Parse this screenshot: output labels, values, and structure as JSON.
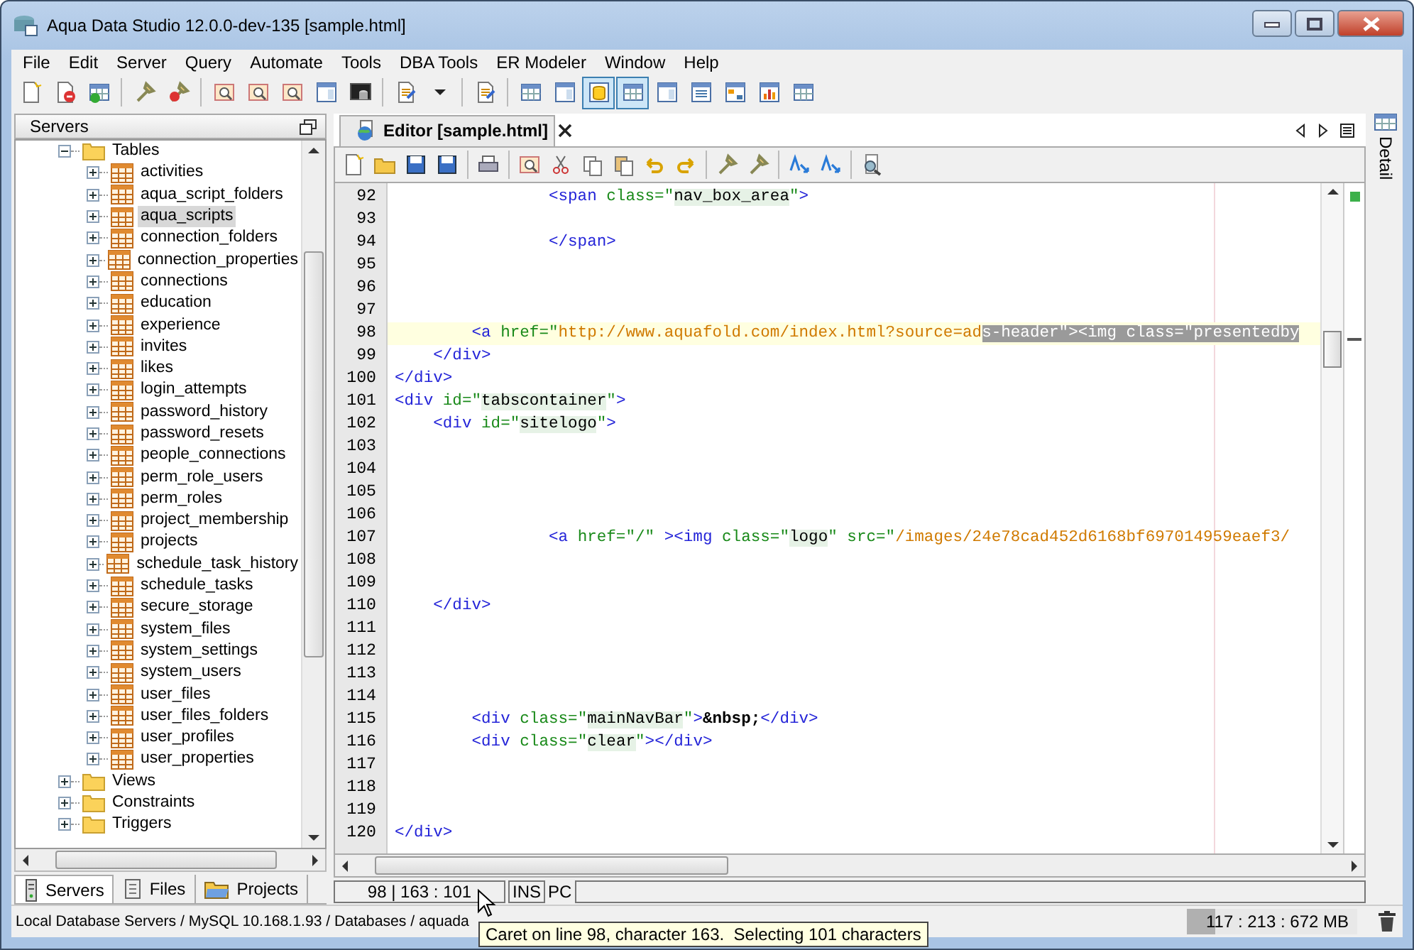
{
  "window": {
    "title": "Aqua Data Studio 12.0.0-dev-135 [sample.html]"
  },
  "menu": [
    "File",
    "Edit",
    "Server",
    "Query",
    "Automate",
    "Tools",
    "DBA Tools",
    "ER Modeler",
    "Window",
    "Help"
  ],
  "main_toolbar": [
    {
      "kind": "page",
      "pressed": false
    },
    {
      "kind": "page-remove",
      "pressed": false
    },
    {
      "kind": "table-add",
      "pressed": false
    },
    {
      "kind": "separator"
    },
    {
      "kind": "tool",
      "pressed": false
    },
    {
      "kind": "tool-remove",
      "pressed": false
    },
    {
      "kind": "separator"
    },
    {
      "kind": "query",
      "pressed": false
    },
    {
      "kind": "query",
      "pressed": false
    },
    {
      "kind": "query",
      "pressed": false
    },
    {
      "kind": "window",
      "pressed": false
    },
    {
      "kind": "db-window",
      "pressed": false
    },
    {
      "kind": "separator"
    },
    {
      "kind": "script",
      "pressed": false
    },
    {
      "kind": "caret",
      "pressed": false
    },
    {
      "kind": "separator"
    },
    {
      "kind": "script",
      "pressed": false
    },
    {
      "kind": "separator"
    },
    {
      "kind": "table",
      "pressed": false
    },
    {
      "kind": "window",
      "pressed": false
    },
    {
      "kind": "db",
      "pressed": true
    },
    {
      "kind": "table",
      "pressed": true
    },
    {
      "kind": "window",
      "pressed": false
    },
    {
      "kind": "list",
      "pressed": false
    },
    {
      "kind": "tree",
      "pressed": false
    },
    {
      "kind": "chart",
      "pressed": false
    },
    {
      "kind": "table",
      "pressed": false
    }
  ],
  "servers_panel": {
    "title": "Servers",
    "tree": [
      {
        "label": "Tables",
        "kind": "folder",
        "expanded": true,
        "selected": false,
        "children": [
          {
            "label": "activities",
            "kind": "table",
            "expanded": false,
            "selected": false
          },
          {
            "label": "aqua_script_folders",
            "kind": "table",
            "expanded": false,
            "selected": false
          },
          {
            "label": "aqua_scripts",
            "kind": "table",
            "expanded": false,
            "selected": true
          },
          {
            "label": "connection_folders",
            "kind": "table",
            "expanded": false,
            "selected": false
          },
          {
            "label": "connection_properties",
            "kind": "table",
            "expanded": false,
            "selected": false
          },
          {
            "label": "connections",
            "kind": "table",
            "expanded": false,
            "selected": false
          },
          {
            "label": "education",
            "kind": "table",
            "expanded": false,
            "selected": false
          },
          {
            "label": "experience",
            "kind": "table",
            "expanded": false,
            "selected": false
          },
          {
            "label": "invites",
            "kind": "table",
            "expanded": false,
            "selected": false
          },
          {
            "label": "likes",
            "kind": "table",
            "expanded": false,
            "selected": false
          },
          {
            "label": "login_attempts",
            "kind": "table",
            "expanded": false,
            "selected": false
          },
          {
            "label": "password_history",
            "kind": "table",
            "expanded": false,
            "selected": false
          },
          {
            "label": "password_resets",
            "kind": "table",
            "expanded": false,
            "selected": false
          },
          {
            "label": "people_connections",
            "kind": "table",
            "expanded": false,
            "selected": false
          },
          {
            "label": "perm_role_users",
            "kind": "table",
            "expanded": false,
            "selected": false
          },
          {
            "label": "perm_roles",
            "kind": "table",
            "expanded": false,
            "selected": false
          },
          {
            "label": "project_membership",
            "kind": "table",
            "expanded": false,
            "selected": false
          },
          {
            "label": "projects",
            "kind": "table",
            "expanded": false,
            "selected": false
          },
          {
            "label": "schedule_task_history",
            "kind": "table",
            "expanded": false,
            "selected": false
          },
          {
            "label": "schedule_tasks",
            "kind": "table",
            "expanded": false,
            "selected": false
          },
          {
            "label": "secure_storage",
            "kind": "table",
            "expanded": false,
            "selected": false
          },
          {
            "label": "system_files",
            "kind": "table",
            "expanded": false,
            "selected": false
          },
          {
            "label": "system_settings",
            "kind": "table",
            "expanded": false,
            "selected": false
          },
          {
            "label": "system_users",
            "kind": "table",
            "expanded": false,
            "selected": false
          },
          {
            "label": "user_files",
            "kind": "table",
            "expanded": false,
            "selected": false
          },
          {
            "label": "user_files_folders",
            "kind": "table",
            "expanded": false,
            "selected": false
          },
          {
            "label": "user_profiles",
            "kind": "table",
            "expanded": false,
            "selected": false
          },
          {
            "label": "user_properties",
            "kind": "table",
            "expanded": false,
            "selected": false
          }
        ]
      },
      {
        "label": "Views",
        "kind": "folder",
        "expanded": false,
        "selected": false
      },
      {
        "label": "Constraints",
        "kind": "folder",
        "expanded": false,
        "selected": false
      },
      {
        "label": "Triggers",
        "kind": "folder",
        "expanded": false,
        "selected": false
      }
    ],
    "tabs": [
      {
        "label": "Servers",
        "kind": "servers",
        "selected": true
      },
      {
        "label": "Files",
        "kind": "files",
        "selected": false
      },
      {
        "label": "Projects",
        "kind": "projects",
        "selected": false
      }
    ]
  },
  "editor": {
    "tab": {
      "label": "Editor [sample.html]"
    },
    "toolbar": [
      {
        "kind": "page"
      },
      {
        "kind": "folder"
      },
      {
        "kind": "disk"
      },
      {
        "kind": "disk-all"
      },
      {
        "kind": "separator"
      },
      {
        "kind": "printer"
      },
      {
        "kind": "separator"
      },
      {
        "kind": "select"
      },
      {
        "kind": "scissors"
      },
      {
        "kind": "copy"
      },
      {
        "kind": "paste"
      },
      {
        "kind": "undo"
      },
      {
        "kind": "redo"
      },
      {
        "kind": "separator"
      },
      {
        "kind": "tool"
      },
      {
        "kind": "tool"
      },
      {
        "kind": "separator"
      },
      {
        "kind": "case"
      },
      {
        "kind": "case"
      },
      {
        "kind": "separator"
      },
      {
        "kind": "find"
      }
    ],
    "lines": [
      {
        "number": "92",
        "current": false,
        "tokens": [
          {
            "t": "                <span ",
            "kind": "tag"
          },
          {
            "t": "class=\"",
            "kind": "attr"
          },
          {
            "t": "nav_box_area",
            "kind": "val"
          },
          {
            "t": "\"",
            "kind": "attr"
          },
          {
            "t": ">",
            "kind": "tag"
          }
        ]
      },
      {
        "number": "93",
        "current": false
      },
      {
        "number": "94",
        "current": false,
        "tokens": [
          {
            "t": "                </span>",
            "kind": "tag"
          }
        ]
      },
      {
        "number": "95",
        "current": false
      },
      {
        "number": "96",
        "current": false
      },
      {
        "number": "97",
        "current": false
      },
      {
        "number": "98",
        "current": true,
        "tokens": [
          {
            "t": "        <a ",
            "kind": "tag"
          },
          {
            "t": "href=\"",
            "kind": "attr"
          },
          {
            "t": "http://www.aquafold.com/index.html?source=ad",
            "kind": "str"
          },
          {
            "t": "s-header\"><img class=\"presentedby",
            "kind": "sel"
          }
        ]
      },
      {
        "number": "99",
        "current": false,
        "tokens": [
          {
            "t": "    </div>",
            "kind": "tag"
          }
        ]
      },
      {
        "number": "100",
        "current": false,
        "tokens": [
          {
            "t": "</div>",
            "kind": "tag"
          }
        ]
      },
      {
        "number": "101",
        "current": false,
        "tokens": [
          {
            "t": "<div ",
            "kind": "tag"
          },
          {
            "t": "id=\"",
            "kind": "attr"
          },
          {
            "t": "tabscontainer",
            "kind": "val"
          },
          {
            "t": "\"",
            "kind": "attr"
          },
          {
            "t": ">",
            "kind": "tag"
          }
        ]
      },
      {
        "number": "102",
        "current": false,
        "tokens": [
          {
            "t": "    <div ",
            "kind": "tag"
          },
          {
            "t": "id=\"",
            "kind": "attr"
          },
          {
            "t": "sitelogo",
            "kind": "val"
          },
          {
            "t": "\"",
            "kind": "attr"
          },
          {
            "t": ">",
            "kind": "tag"
          }
        ]
      },
      {
        "number": "103",
        "current": false
      },
      {
        "number": "104",
        "current": false
      },
      {
        "number": "105",
        "current": false
      },
      {
        "number": "106",
        "current": false
      },
      {
        "number": "107",
        "current": false,
        "tokens": [
          {
            "t": "                <a ",
            "kind": "tag"
          },
          {
            "t": "href=\"/\" ",
            "kind": "attr"
          },
          {
            "t": "><img ",
            "kind": "tag"
          },
          {
            "t": "class=\"",
            "kind": "attr"
          },
          {
            "t": "logo",
            "kind": "val"
          },
          {
            "t": "\" src=\"",
            "kind": "attr"
          },
          {
            "t": "/images/24e78cad452d6168bf697014959eaef3/",
            "kind": "str"
          }
        ]
      },
      {
        "number": "108",
        "current": false
      },
      {
        "number": "109",
        "current": false
      },
      {
        "number": "110",
        "current": false,
        "tokens": [
          {
            "t": "    </div>",
            "kind": "tag"
          }
        ]
      },
      {
        "number": "111",
        "current": false
      },
      {
        "number": "112",
        "current": false
      },
      {
        "number": "113",
        "current": false
      },
      {
        "number": "114",
        "current": false
      },
      {
        "number": "115",
        "current": false,
        "tokens": [
          {
            "t": "        <div ",
            "kind": "tag"
          },
          {
            "t": "class=\"",
            "kind": "attr"
          },
          {
            "t": "mainNavBar",
            "kind": "val"
          },
          {
            "t": "\"",
            "kind": "attr"
          },
          {
            "t": ">",
            "kind": "tag"
          },
          {
            "t": "&nbsp;",
            "kind": "ent"
          },
          {
            "t": "</div>",
            "kind": "tag"
          }
        ]
      },
      {
        "number": "116",
        "current": false,
        "tokens": [
          {
            "t": "        <div ",
            "kind": "tag"
          },
          {
            "t": "class=\"",
            "kind": "attr"
          },
          {
            "t": "clear",
            "kind": "val"
          },
          {
            "t": "\"",
            "kind": "attr"
          },
          {
            "t": "></div>",
            "kind": "tag"
          }
        ]
      },
      {
        "number": "117",
        "current": false
      },
      {
        "number": "118",
        "current": false
      },
      {
        "number": "119",
        "current": false
      },
      {
        "number": "120",
        "current": false,
        "tokens": [
          {
            "t": "</div>",
            "kind": "tag"
          }
        ]
      }
    ],
    "status": {
      "position": "98 | 163 : 101",
      "mode": "INS",
      "line_ending": "PC"
    }
  },
  "detail_tab": {
    "label": "Detail"
  },
  "status_bar": {
    "path": "Local Database Servers / MySQL 10.168.1.93 / Databases / aquada",
    "memory": {
      "reading": "117 : 213 : 672 MB",
      "level": 0.17
    }
  },
  "tooltip": {
    "text": "Caret on line 98, character 163.  Selecting 101 characters"
  }
}
